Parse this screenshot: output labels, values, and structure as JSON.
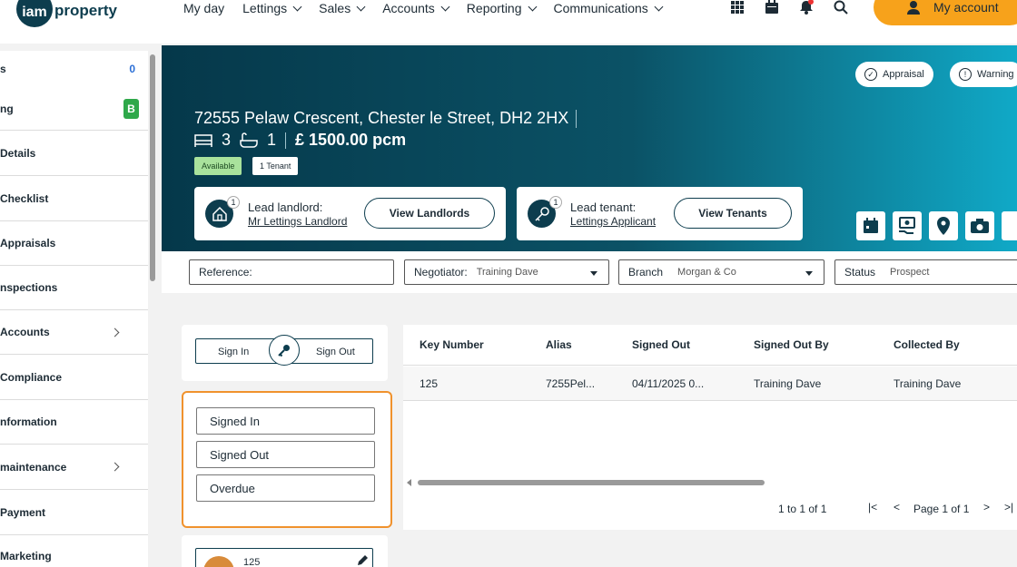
{
  "topnav": {
    "logo_mark": "iam",
    "logo_text": "property",
    "items": [
      "My day",
      "Lettings",
      "Sales",
      "Accounts",
      "Reporting",
      "Communications"
    ],
    "account_label": "My account",
    "icons": [
      "apps-grid-icon",
      "calendar-icon",
      "bell-icon",
      "search-icon",
      "user-icon"
    ]
  },
  "sidebar": {
    "items": [
      {
        "label": "s",
        "badge": "0"
      },
      {
        "label": "ng",
        "badge": "B"
      },
      {
        "label": "Details"
      },
      {
        "label": "Checklist"
      },
      {
        "label": "Appraisals"
      },
      {
        "label": "nspections"
      },
      {
        "label": "Accounts",
        "has_children": true
      },
      {
        "label": "Compliance"
      },
      {
        "label": "nformation"
      },
      {
        "label": "maintenance",
        "has_children": true
      },
      {
        "label": "Payment"
      },
      {
        "label": "Marketing"
      }
    ]
  },
  "hero": {
    "pills": [
      "Appraisal",
      "Warning"
    ],
    "address": "72555 Pelaw Crescent, Chester le Street, DH2 2HX",
    "bedrooms": "3",
    "bathrooms": "1",
    "price": "£ 1500.00 pcm",
    "tags": [
      "Available",
      "1 Tenant"
    ],
    "landlord": {
      "count": "1",
      "title": "Lead landlord:",
      "name": "Mr Lettings Landlord",
      "button": "View Landlords"
    },
    "tenant": {
      "count": "1",
      "title": "Lead tenant:",
      "name": "Lettings Applicant",
      "button": "View Tenants"
    },
    "action_icons": [
      "calendar-icon",
      "money-hand-icon",
      "location-pin-icon",
      "camera-icon"
    ]
  },
  "filters": {
    "reference": {
      "label": "Reference:",
      "value": ""
    },
    "negotiator": {
      "label": "Negotiator:",
      "value": "Training Dave"
    },
    "branch": {
      "label": "Branch",
      "value": "Morgan & Co"
    },
    "status": {
      "label": "Status",
      "value": "Prospect"
    }
  },
  "keys": {
    "sign_in": "Sign In",
    "sign_out": "Sign Out",
    "filter_options": [
      "Signed In",
      "Signed Out",
      "Overdue"
    ],
    "key_card_number": "125"
  },
  "table": {
    "columns": [
      "Key Number",
      "Alias",
      "Signed Out",
      "Signed Out By",
      "Collected By"
    ],
    "rows": [
      [
        "125",
        "7255Pel...",
        "04/11/2025 0...",
        "Training Dave",
        "Training Dave"
      ]
    ],
    "pagination": {
      "summary": "1 to 1 of 1",
      "page": "Page 1 of 1"
    }
  },
  "colors": {
    "brand_dark": "#0d3d4e",
    "accent_orange": "#f7a21b",
    "highlight_border": "#f0922d",
    "available_tag": "#a9e29c"
  }
}
